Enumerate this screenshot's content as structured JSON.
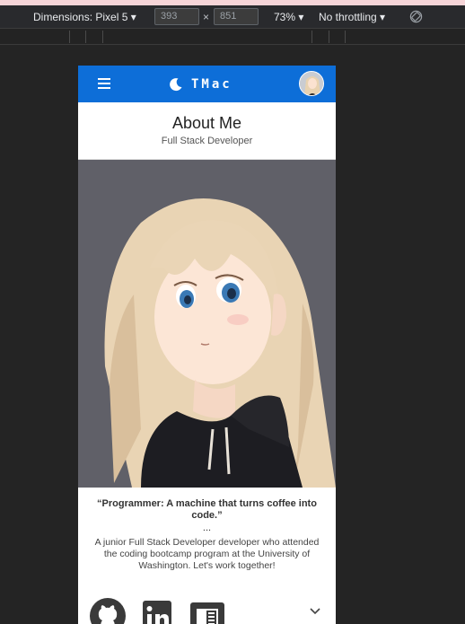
{
  "devtools": {
    "dimensions_label": "Dimensions: Pixel 5 ▾",
    "width_value": "393",
    "height_value": "851",
    "times_glyph": "×",
    "zoom_label": "73% ▾",
    "throttle_label": "No throttling ▾"
  },
  "navbar": {
    "brand": "TMac",
    "colors": {
      "bar": "#0d6ed8",
      "text": "#ffffff"
    }
  },
  "header": {
    "title": "About Me",
    "subtitle": "Full Stack Developer"
  },
  "content": {
    "quote": "“Programmer: A machine that turns coffee into code.”",
    "ellipsis": "...",
    "bio": "A junior Full Stack Developer developer who attended the coding bootcamp program at the University of Washington. Let's work together!"
  },
  "social_links": [
    "github-icon",
    "linkedin-icon",
    "resume-icon"
  ]
}
